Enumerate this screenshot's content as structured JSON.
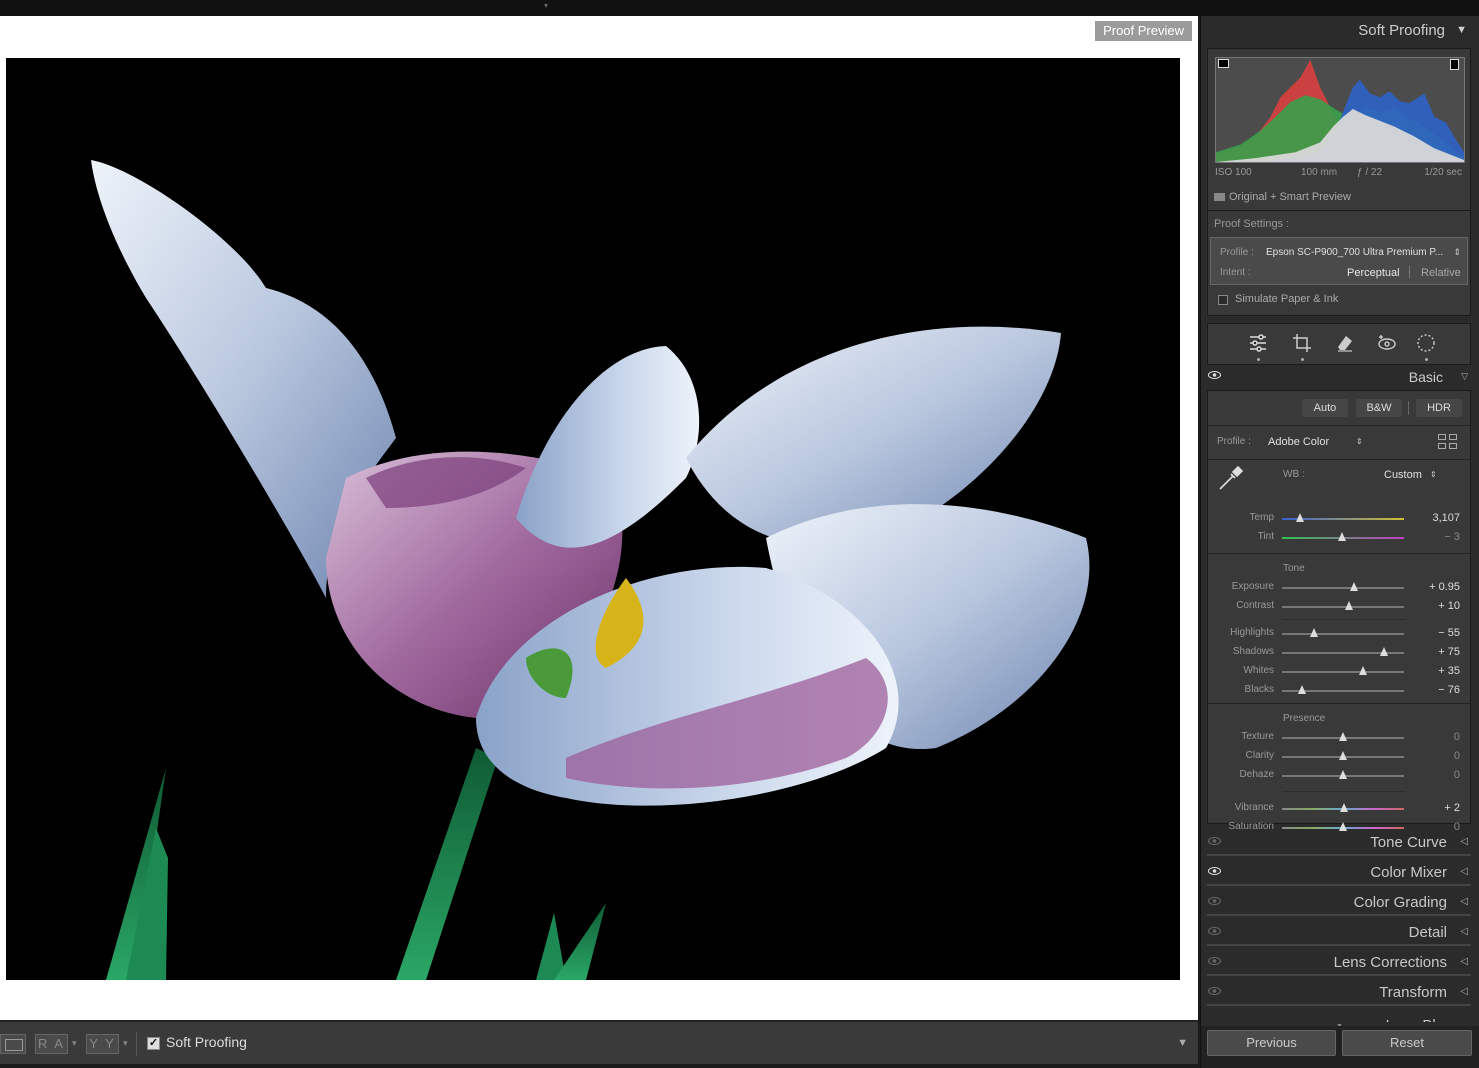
{
  "canvas": {
    "badge": "Proof Preview"
  },
  "toolbar": {
    "before_after": "R A",
    "before_after_2": "Y Y",
    "soft_proofing_label": "Soft Proofing",
    "soft_proofing_checked": true
  },
  "panel": {
    "title": "Soft Proofing",
    "exif": {
      "iso": "ISO 100",
      "focal": "100 mm",
      "aperture": "ƒ / 22",
      "shutter": "1/20 sec"
    },
    "preview_status": "Original + Smart Preview",
    "proof_settings": {
      "label": "Proof Settings :",
      "profile_label": "Profile :",
      "profile_value": "Epson SC-P900_700 Ultra Premium P...",
      "intent_label": "Intent :",
      "intent_perceptual": "Perceptual",
      "intent_relative": "Relative",
      "selected_intent": "Perceptual",
      "simulate_label": "Simulate Paper & Ink",
      "simulate_checked": false
    },
    "tools": [
      "edit-sliders-icon",
      "crop-icon",
      "eraser-icon",
      "redeye-icon",
      "masking-icon"
    ],
    "basic": {
      "title": "Basic",
      "auto": "Auto",
      "bw": "B&W",
      "hdr": "HDR",
      "profile_label": "Profile :",
      "profile_value": "Adobe Color",
      "wb_label": "WB :",
      "wb_value": "Custom",
      "tone_label": "Tone",
      "presence_label": "Presence",
      "sliders": {
        "temp": {
          "label": "Temp",
          "value": "3,107",
          "pos": 0.15
        },
        "tint": {
          "label": "Tint",
          "value": "− 3",
          "pos": 0.49
        },
        "exposure": {
          "label": "Exposure",
          "value": "+ 0.95",
          "pos": 0.59
        },
        "contrast": {
          "label": "Contrast",
          "value": "+ 10",
          "pos": 0.55
        },
        "highlights": {
          "label": "Highlights",
          "value": "− 55",
          "pos": 0.26
        },
        "shadows": {
          "label": "Shadows",
          "value": "+ 75",
          "pos": 0.84
        },
        "whites": {
          "label": "Whites",
          "value": "+ 35",
          "pos": 0.66
        },
        "blacks": {
          "label": "Blacks",
          "value": "− 76",
          "pos": 0.16
        },
        "texture": {
          "label": "Texture",
          "value": "0",
          "pos": 0.5
        },
        "clarity": {
          "label": "Clarity",
          "value": "0",
          "pos": 0.5
        },
        "dehaze": {
          "label": "Dehaze",
          "value": "0",
          "pos": 0.5
        },
        "vibrance": {
          "label": "Vibrance",
          "value": "+ 2",
          "pos": 0.51
        },
        "saturation": {
          "label": "Saturation",
          "value": "0",
          "pos": 0.5
        }
      }
    },
    "collapsed_panels": [
      "Tone Curve",
      "Color Mixer",
      "Color Grading",
      "Detail",
      "Lens Corrections",
      "Transform",
      "Lens Blur"
    ],
    "previous": "Previous",
    "reset": "Reset"
  },
  "colors": {
    "panel_bg": "#2b2b2b",
    "accent_white": "#ffffff"
  }
}
